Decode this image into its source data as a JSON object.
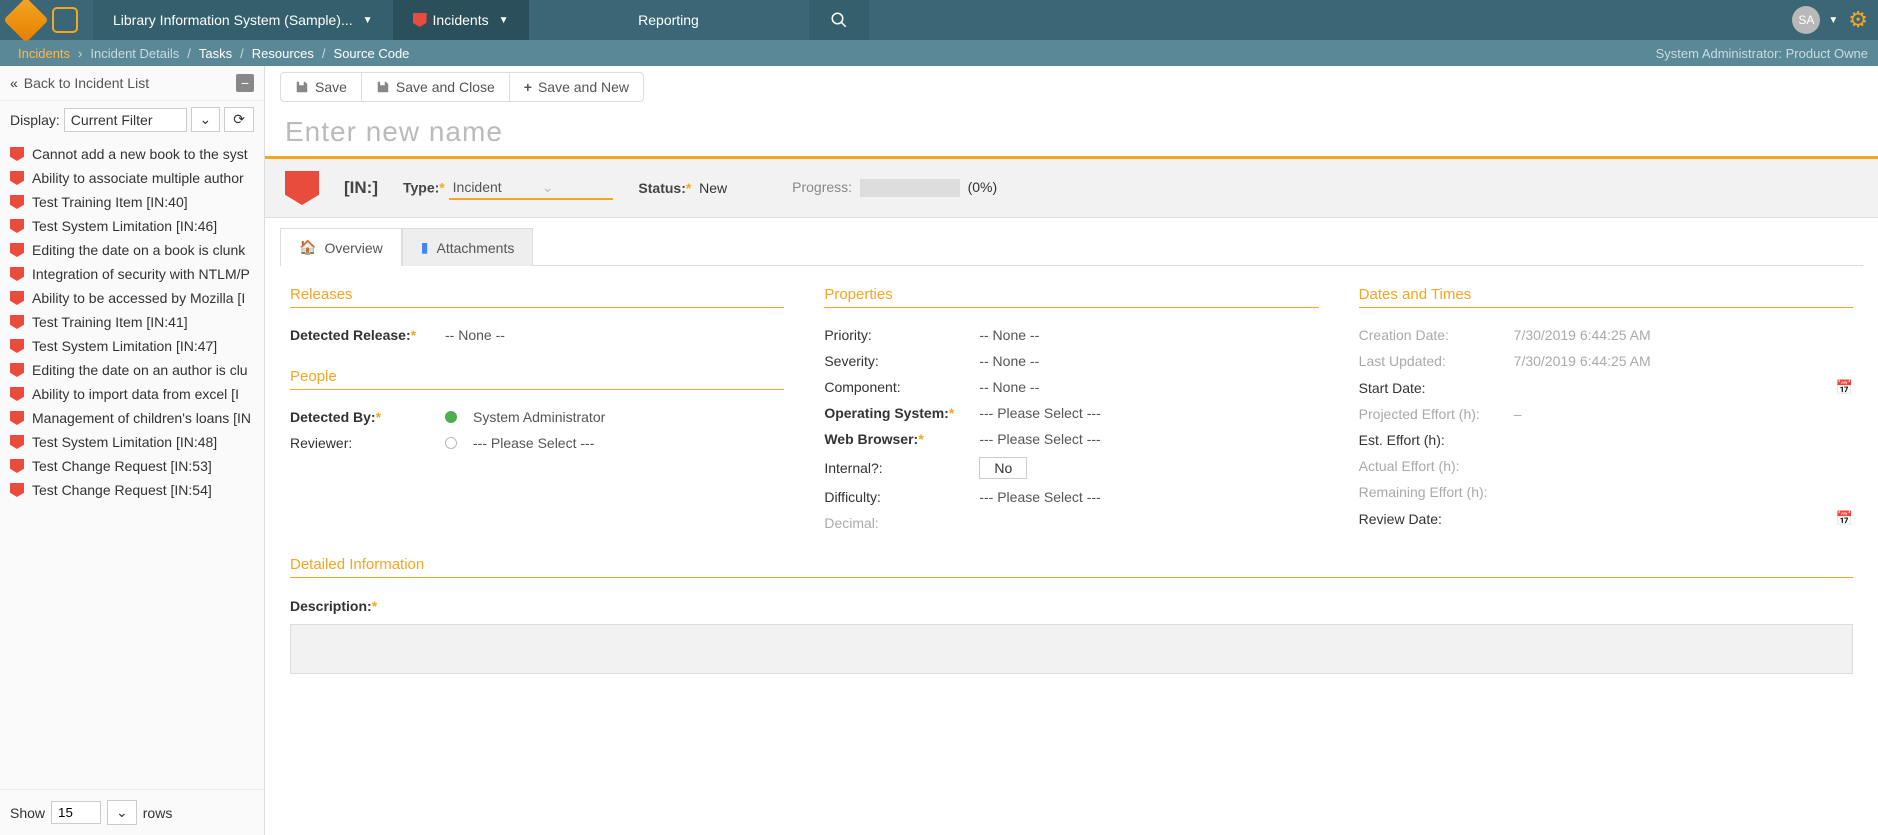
{
  "nav": {
    "product": "Library Information System (Sample)...",
    "incidents": "Incidents",
    "reporting": "Reporting",
    "avatar": "SA"
  },
  "breadcrumb": {
    "incidents": "Incidents",
    "details": "Incident Details",
    "tasks": "Tasks",
    "resources": "Resources",
    "source": "Source Code",
    "role": "System Administrator: Product Owne"
  },
  "sidebar": {
    "back": "Back to Incident List",
    "display_label": "Display:",
    "filter": "Current Filter",
    "items": [
      "Cannot add a new book to the syst",
      "Ability to associate multiple author",
      "Test Training Item [IN:40]",
      "Test System Limitation [IN:46]",
      "Editing the date on a book is clunk",
      "Integration of security with NTLM/P",
      "Ability to be accessed by Mozilla [I",
      "Test Training Item [IN:41]",
      "Test System Limitation [IN:47]",
      "Editing the date on an author is clu",
      "Ability to import data from excel [I",
      "Management of children's loans [IN",
      "Test System Limitation [IN:48]",
      "Test Change Request [IN:53]",
      "Test Change Request [IN:54]"
    ],
    "show": "Show",
    "show_count": "15",
    "rows": "rows"
  },
  "toolbar": {
    "save": "Save",
    "save_close": "Save and Close",
    "save_new": "Save and New"
  },
  "name_placeholder": "Enter new name",
  "info": {
    "id": "[IN:]",
    "type_label": "Type:",
    "type_value": "Incident",
    "status_label": "Status:",
    "status_value": "New",
    "progress_label": "Progress:",
    "progress_value": "(0%)"
  },
  "tabs": {
    "overview": "Overview",
    "attachments": "Attachments"
  },
  "sections": {
    "releases": {
      "title": "Releases",
      "detected_release": "Detected Release:",
      "detected_release_value": "-- None --"
    },
    "people": {
      "title": "People",
      "detected_by": "Detected By:",
      "detected_by_value": "System Administrator",
      "reviewer": "Reviewer:",
      "reviewer_value": "--- Please Select ---"
    },
    "properties": {
      "title": "Properties",
      "priority": "Priority:",
      "priority_value": "-- None --",
      "severity": "Severity:",
      "severity_value": "-- None --",
      "component": "Component:",
      "component_value": "-- None --",
      "os": "Operating System:",
      "os_value": "--- Please Select ---",
      "browser": "Web Browser:",
      "browser_value": "--- Please Select ---",
      "internal": "Internal?:",
      "internal_value": "No",
      "difficulty": "Difficulty:",
      "difficulty_value": "--- Please Select ---",
      "decimal": "Decimal:"
    },
    "dates": {
      "title": "Dates and Times",
      "creation": "Creation Date:",
      "creation_value": "7/30/2019 6:44:25 AM",
      "updated": "Last Updated:",
      "updated_value": "7/30/2019 6:44:25 AM",
      "start": "Start Date:",
      "projected": "Projected Effort (h):",
      "projected_value": "–",
      "est": "Est. Effort (h):",
      "actual": "Actual Effort (h):",
      "remaining": "Remaining Effort (h):",
      "review": "Review Date:"
    },
    "detailed": {
      "title": "Detailed Information",
      "description": "Description:"
    }
  }
}
